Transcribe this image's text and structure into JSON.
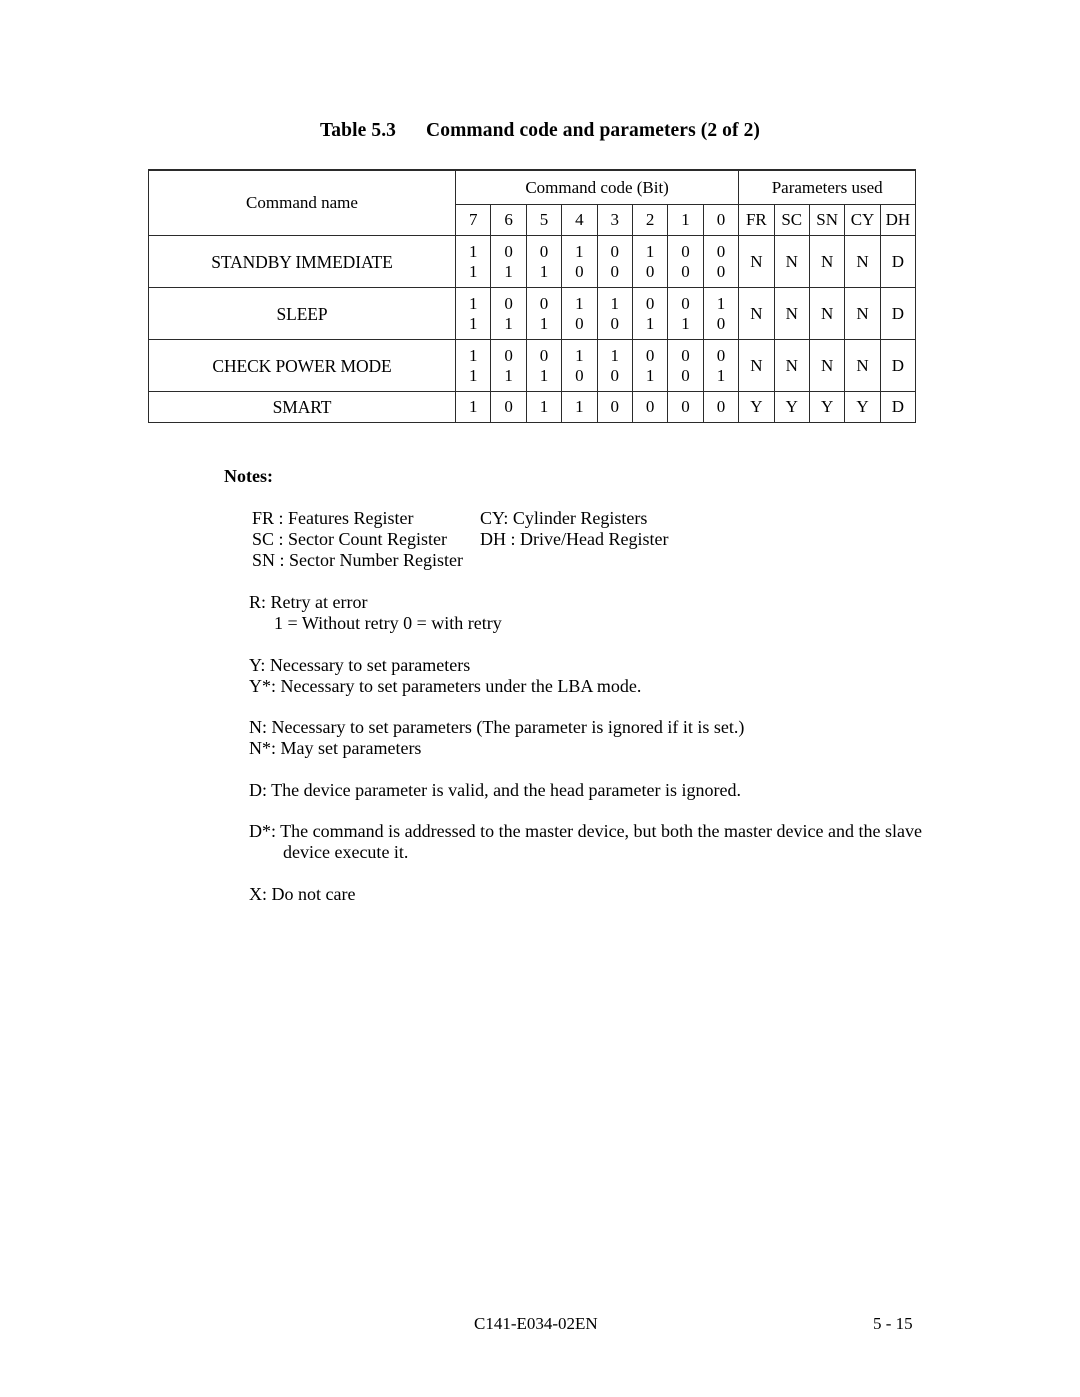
{
  "title": {
    "number": "Table 5.3",
    "text": "Command code and parameters (2 of 2)"
  },
  "table": {
    "header": {
      "command_name": "Command name",
      "command_code_group": "Command code (Bit)",
      "parameters_group": "Parameters used",
      "bit_labels": [
        "7",
        "6",
        "5",
        "4",
        "3",
        "2",
        "1",
        "0"
      ],
      "parameter_labels": [
        "FR",
        "SC",
        "SN",
        "CY",
        "DH"
      ]
    },
    "rows": [
      {
        "name": "STANDBY IMMEDIATE",
        "type": "double",
        "bits_line1": [
          "1",
          "0",
          "0",
          "1",
          "0",
          "1",
          "0",
          "0"
        ],
        "bits_line2": [
          "1",
          "1",
          "1",
          "0",
          "0",
          "0",
          "0",
          "0"
        ],
        "parameters": [
          "N",
          "N",
          "N",
          "N",
          "D"
        ]
      },
      {
        "name": "SLEEP",
        "type": "double",
        "bits_line1": [
          "1",
          "0",
          "0",
          "1",
          "1",
          "0",
          "0",
          "1"
        ],
        "bits_line2": [
          "1",
          "1",
          "1",
          "0",
          "0",
          "1",
          "1",
          "0"
        ],
        "parameters": [
          "N",
          "N",
          "N",
          "N",
          "D"
        ]
      },
      {
        "name": "CHECK POWER MODE",
        "type": "double",
        "bits_line1": [
          "1",
          "0",
          "0",
          "1",
          "1",
          "0",
          "0",
          "0"
        ],
        "bits_line2": [
          "1",
          "1",
          "1",
          "0",
          "0",
          "1",
          "0",
          "1"
        ],
        "parameters": [
          "N",
          "N",
          "N",
          "N",
          "D"
        ]
      },
      {
        "name": "SMART",
        "type": "single",
        "bits_line1": [
          "1",
          "0",
          "1",
          "1",
          "0",
          "0",
          "0",
          "0"
        ],
        "bits_line2": null,
        "parameters": [
          "Y",
          "Y",
          "Y",
          "Y",
          "D"
        ]
      }
    ]
  },
  "notes": {
    "heading": "Notes:",
    "registers": [
      {
        "left": "FR : Features Register",
        "right": "CY: Cylinder Registers"
      },
      {
        "left": "SC : Sector Count Register",
        "right": "DH : Drive/Head Register"
      },
      {
        "left": "SN : Sector Number Register",
        "right": ""
      }
    ],
    "retry_line1": "R: Retry at error",
    "retry_line2": "1 = Without retry  0 = with retry",
    "y_line": "Y:  Necessary to set parameters",
    "ystar_line": "Y*: Necessary to set parameters under the LBA mode.",
    "n_line": "N:  Necessary to set parameters (The parameter is ignored if it is set.)",
    "nstar_line": "N*: May set parameters",
    "d_line": "D:  The device parameter is valid, and the head parameter is ignored.",
    "dstar_line": "D*: The command is addressed to the master device, but both the master device and the slave",
    "dstar_line_cont": "device execute it.",
    "x_line": "X:  Do not care"
  },
  "footer": {
    "document_id": "C141-E034-02EN",
    "page_number": "5 - 15"
  }
}
